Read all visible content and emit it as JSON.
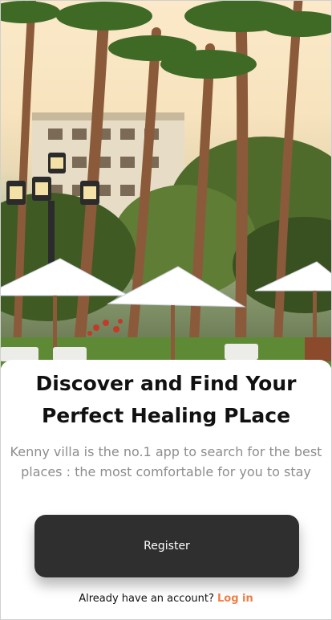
{
  "hero": {
    "image_description_icon": "resort-photo-icon"
  },
  "content": {
    "headline_line1": "Discover and Find Your",
    "headline_line2": "Perfect Healing PLace",
    "subtitle_line1": "Kenny villa is the no.1 app to search for the best",
    "subtitle_line2": "places : the most comfortable for you to stay"
  },
  "actions": {
    "register_label": "Register",
    "account_prompt": "Already have an account?",
    "login_label": "Log in"
  },
  "colors": {
    "button_bg": "#2f2f2f",
    "accent": "#ee7d45",
    "subtitle": "#8d8d8d"
  }
}
